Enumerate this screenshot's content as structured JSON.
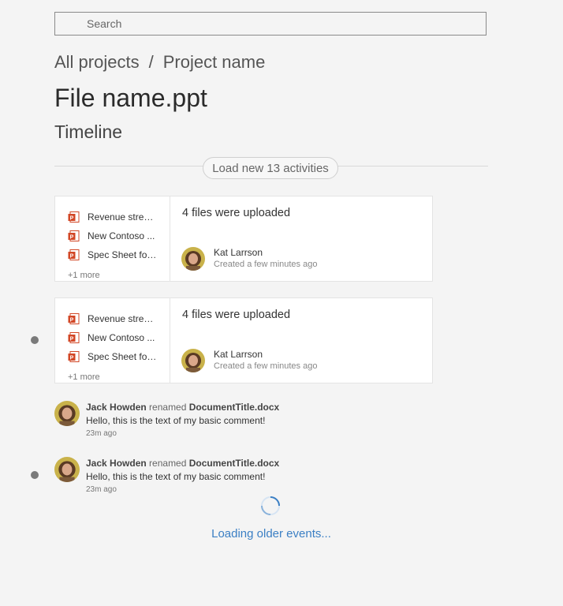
{
  "search": {
    "placeholder": "Search"
  },
  "breadcrumb": {
    "root": "All projects",
    "separator": "/",
    "current": "Project name"
  },
  "page": {
    "title": "File name.ppt",
    "subtitle": "Timeline"
  },
  "load_new": {
    "label": "Load new 13 activities"
  },
  "cards": [
    {
      "files": [
        "Revenue streams.pptx",
        "New Contoso ...",
        "Spec Sheet for ..."
      ],
      "more": "+1 more",
      "summary": "4 files were uploaded",
      "author": "Kat Larrson",
      "meta": "Created a few minutes ago"
    },
    {
      "files": [
        "Revenue streams.pptx",
        "New Contoso ...",
        "Spec Sheet for ..."
      ],
      "more": "+1 more",
      "summary": "4 files were uploaded",
      "author": "Kat Larrson",
      "meta": "Created a few minutes ago"
    }
  ],
  "comments": [
    {
      "author": "Jack Howden",
      "action": "renamed",
      "target": "DocumentTitle.docx",
      "text": "Hello, this is the text of my basic comment!",
      "time": "23m ago"
    },
    {
      "author": "Jack Howden",
      "action": "renamed",
      "target": "DocumentTitle.docx",
      "text": "Hello, this is the text of my basic comment!",
      "time": "23m ago"
    }
  ],
  "loading": {
    "label": "Loading older events..."
  },
  "colors": {
    "accent": "#3b7fc4",
    "ppt": "#d24726",
    "background": "#f4f4f4"
  }
}
